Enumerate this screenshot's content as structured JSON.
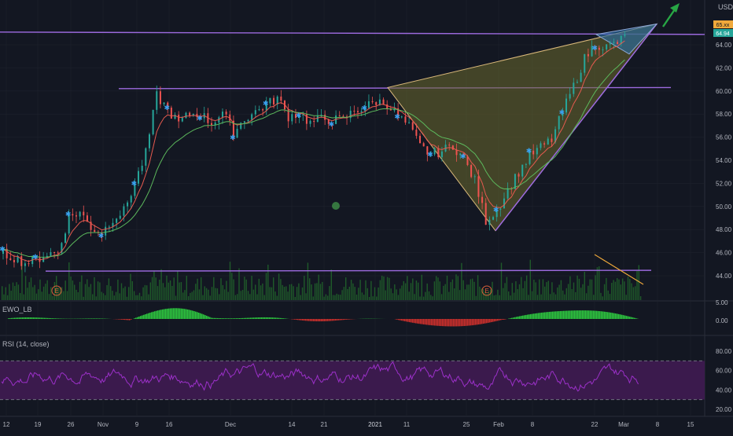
{
  "currency": "USD",
  "price_tags": {
    "upper": "65.xx",
    "lower": "64.94"
  },
  "indicators": {
    "ewo_label": "EWO_LB",
    "rsi_label": "RSI (14, close)"
  },
  "earnings_marker": "E",
  "colors": {
    "background": "#131722",
    "grid": "#1e222d",
    "up_candle": "#26a69a",
    "down_candle": "#ef5350",
    "pattern_line": "#9c6ade",
    "pattern_fill": "#6b6a2e",
    "wedge_fill": "#2a6ea8",
    "ema_fast": "#e65a4f",
    "ema_slow": "#5cb85c",
    "marker": "#3aa0f0",
    "volume": "#1f5a2a",
    "ewo_pos": "#2ecc40",
    "ewo_neg": "#d0302c",
    "rsi_line": "#9b30c8",
    "rsi_band": "#3b1a4d",
    "arrow": "#28a745",
    "price_tag_upper": "#f0a93b",
    "price_tag_lower": "#26a69a"
  },
  "chart_data": [
    {
      "type": "line",
      "name": "price",
      "x_ticks": [
        "12",
        "19",
        "26",
        "Nov",
        "9",
        "16",
        "Dec",
        "14",
        "21",
        "2021",
        "11",
        "25",
        "Feb",
        "8",
        "22",
        "Mar",
        "8",
        "15"
      ],
      "y_ticks": [
        "64.00",
        "62.00",
        "60.00",
        "58.00",
        "56.00",
        "54.00",
        "52.00",
        "50.00",
        "48.00",
        "46.00",
        "44.00"
      ],
      "ylim": [
        43.0,
        66.5
      ],
      "key_points": {
        "resistance_level": 60.2,
        "breakout_level": 64.9,
        "support_level": 44.4,
        "pattern_low": 47.8,
        "pattern_high": 65.8
      },
      "series": [
        {
          "values": [
            45.9,
            45.6,
            45.1,
            45.4,
            45.9,
            46.0,
            49.1,
            49.5,
            48.2,
            47.7,
            49.0,
            49.6,
            52.0,
            54.6,
            59.6,
            58.4,
            57.2,
            58.0,
            58.0,
            57.2,
            58.2,
            56.4,
            57.6,
            58.2,
            58.8,
            59.4,
            57.8,
            58.1,
            57.2,
            57.6,
            57.5,
            57.5,
            58.3,
            58.6,
            59.1,
            58.9,
            57.8,
            56.9,
            55.2,
            54.5,
            54.8,
            55.3,
            54.1,
            52.2,
            48.8,
            49.7,
            51.4,
            53.0,
            54.4,
            55.1,
            55.8,
            58.2,
            60.4,
            62.8,
            64.1,
            63.8,
            64.2,
            64.9
          ]
        }
      ]
    },
    {
      "type": "bar",
      "name": "EWO_LB",
      "yticks": [
        "5.00",
        "0.00"
      ],
      "ylim": [
        -3,
        6
      ]
    },
    {
      "type": "line",
      "name": "RSI (14, close)",
      "yticks": [
        "80.00",
        "60.00",
        "40.00",
        "20.00"
      ],
      "ylim": [
        15,
        90
      ],
      "bands": [
        70,
        30
      ]
    }
  ]
}
